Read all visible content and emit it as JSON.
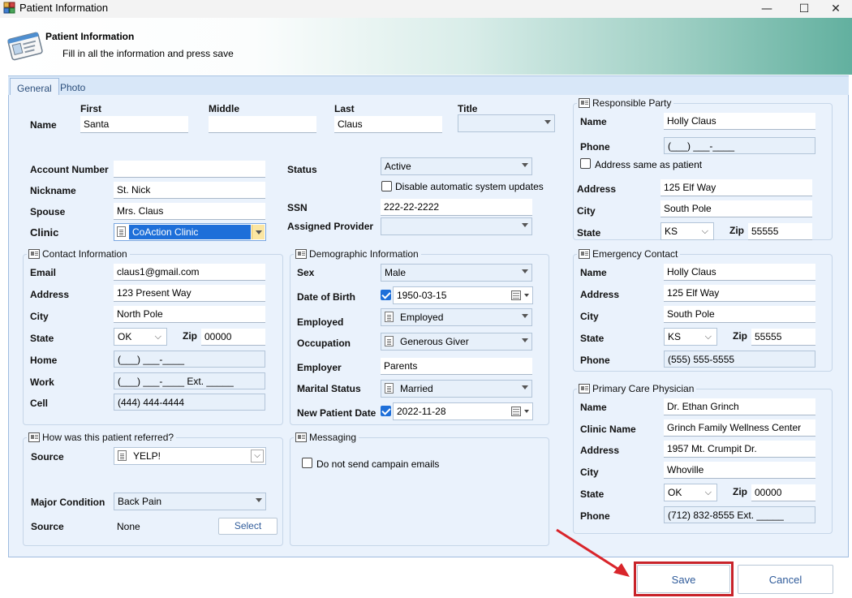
{
  "window": {
    "title": "Patient Information",
    "minimize": "—",
    "maximize": "☐",
    "close": "✕"
  },
  "header": {
    "title": "Patient Information",
    "subtitle": "Fill in all the information and press save"
  },
  "tabs": [
    "General",
    "Photo"
  ],
  "name": {
    "label": "Name",
    "first_label": "First",
    "first": "Santa",
    "middle_label": "Middle",
    "middle": "",
    "last_label": "Last",
    "last": "Claus",
    "title_label": "Title",
    "title": ""
  },
  "account": {
    "account_number_label": "Account Number",
    "account_number": "",
    "nickname_label": "Nickname",
    "nickname": "St. Nick",
    "spouse_label": "Spouse",
    "spouse": "Mrs. Claus",
    "clinic_label": "Clinic",
    "clinic": "CoAction Clinic"
  },
  "status": {
    "status_label": "Status",
    "status": "Active",
    "disable_updates_label": "Disable automatic system updates",
    "ssn_label": "SSN",
    "ssn": "222-22-2222",
    "provider_label": "Assigned Provider",
    "provider": ""
  },
  "contact": {
    "group_title": "Contact Information",
    "email_label": "Email",
    "email": "claus1@gmail.com",
    "address_label": "Address",
    "address": "123 Present Way",
    "city_label": "City",
    "city": "North Pole",
    "state_label": "State",
    "state": "OK",
    "zip_label": "Zip",
    "zip": "00000",
    "home_label": "Home",
    "home": "(___) ___-____",
    "work_label": "Work",
    "work": "(___) ___-____ Ext. _____",
    "cell_label": "Cell",
    "cell": "(444) 444-4444"
  },
  "demographic": {
    "group_title": "Demographic Information",
    "sex_label": "Sex",
    "sex": "Male",
    "dob_label": "Date of Birth",
    "dob": "1950-03-15",
    "employed_label": "Employed",
    "employed": "Employed",
    "occupation_label": "Occupation",
    "occupation": "Generous Giver",
    "employer_label": "Employer",
    "employer": "Parents",
    "marital_label": "Marital Status",
    "marital": "Married",
    "new_patient_label": "New Patient Date",
    "new_patient": "2022-11-28"
  },
  "referral": {
    "group_title": "How was this patient referred?",
    "source_label": "Source",
    "source": "YELP!",
    "major_condition_label": "Major Condition",
    "major_condition": "Back Pain",
    "source2_label": "Source",
    "source2": "None",
    "select_button": "Select"
  },
  "messaging": {
    "group_title": "Messaging",
    "no_campaign_label": "Do not send campain emails"
  },
  "responsible": {
    "group_title": "Responsible Party",
    "name_label": "Name",
    "name": "Holly Claus",
    "phone_label": "Phone",
    "phone": "(___) ___-____",
    "same_address_label": "Address same as patient",
    "address_label": "Address",
    "address": "125 Elf Way",
    "city_label": "City",
    "city": "South Pole",
    "state_label": "State",
    "state": "KS",
    "zip_label": "Zip",
    "zip": "55555"
  },
  "emergency": {
    "group_title": "Emergency Contact",
    "name_label": "Name",
    "name": "Holly Claus",
    "address_label": "Address",
    "address": "125 Elf Way",
    "city_label": "City",
    "city": "South Pole",
    "state_label": "State",
    "state": "KS",
    "zip_label": "Zip",
    "zip": "55555",
    "phone_label": "Phone",
    "phone": "(555) 555-5555"
  },
  "physician": {
    "group_title": "Primary Care Physician",
    "name_label": "Name",
    "name": "Dr. Ethan Grinch",
    "clinic_name_label": "Clinic Name",
    "clinic_name": "Grinch Family Wellness Center",
    "address_label": "Address",
    "address": "1957 Mt. Crumpit Dr.",
    "city_label": "City",
    "city": "Whoville",
    "state_label": "State",
    "state": "OK",
    "zip_label": "Zip",
    "zip": "00000",
    "phone_label": "Phone",
    "phone": "(712) 832-8555 Ext. _____"
  },
  "footer": {
    "save": "Save",
    "cancel": "Cancel"
  },
  "colors": {
    "highlight": "#1e6fd9",
    "annotation_red": "#d9252b",
    "panel": "#eaf2fc",
    "header_teal": "#62b09f"
  }
}
